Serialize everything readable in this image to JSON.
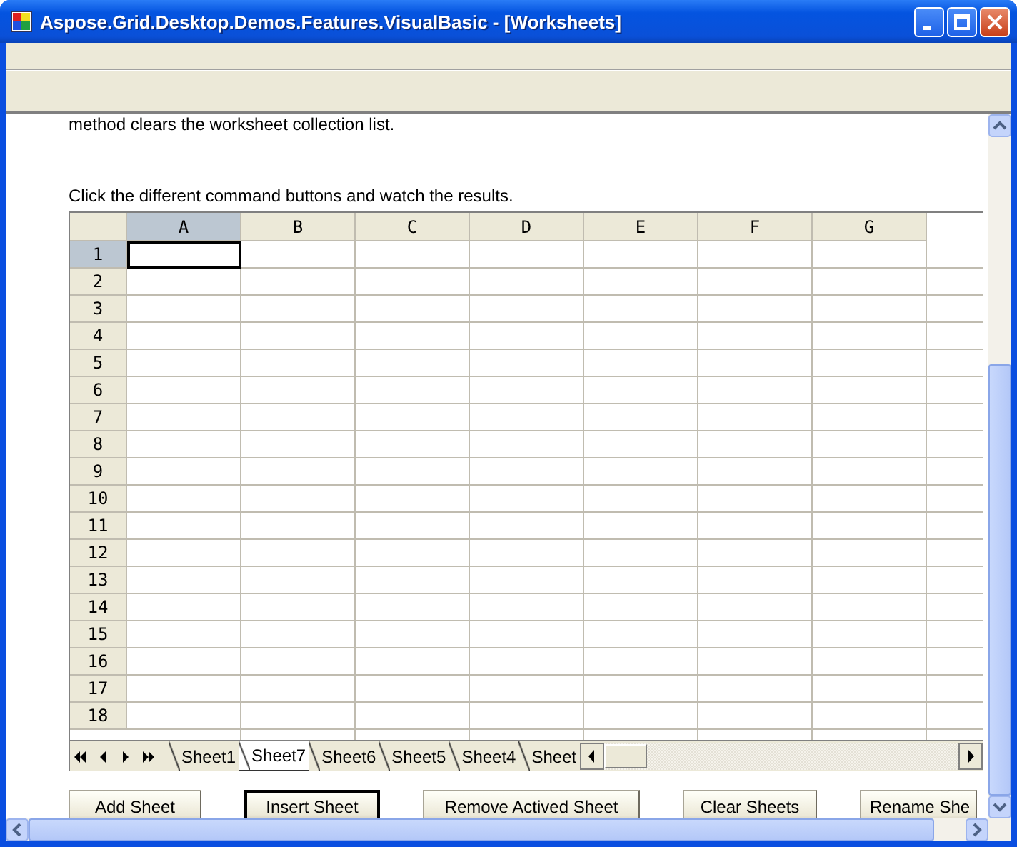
{
  "window": {
    "title": "Aspose.Grid.Desktop.Demos.Features.VisualBasic - [Worksheets]"
  },
  "description": [
    "method clears the worksheet collection list.",
    "Click the different command buttons and watch the results."
  ],
  "grid": {
    "columns": [
      {
        "label": "A",
        "selected": true
      },
      {
        "label": "B",
        "selected": false
      },
      {
        "label": "C",
        "selected": false
      },
      {
        "label": "D",
        "selected": false
      },
      {
        "label": "E",
        "selected": false
      },
      {
        "label": "F",
        "selected": false
      },
      {
        "label": "G",
        "selected": false
      }
    ],
    "rows": [
      {
        "label": "1",
        "selected": true
      },
      {
        "label": "2",
        "selected": false
      },
      {
        "label": "3",
        "selected": false
      },
      {
        "label": "4",
        "selected": false
      },
      {
        "label": "5",
        "selected": false
      },
      {
        "label": "6",
        "selected": false
      },
      {
        "label": "7",
        "selected": false
      },
      {
        "label": "8",
        "selected": false
      },
      {
        "label": "9",
        "selected": false
      },
      {
        "label": "10",
        "selected": false
      },
      {
        "label": "11",
        "selected": false
      },
      {
        "label": "12",
        "selected": false
      },
      {
        "label": "13",
        "selected": false
      },
      {
        "label": "14",
        "selected": false
      },
      {
        "label": "15",
        "selected": false
      },
      {
        "label": "16",
        "selected": false
      },
      {
        "label": "17",
        "selected": false
      },
      {
        "label": "18",
        "selected": false
      }
    ]
  },
  "sheet_tabs": [
    {
      "label": "Sheet1",
      "selected": false
    },
    {
      "label": "Sheet7",
      "selected": true
    },
    {
      "label": "Sheet6",
      "selected": false
    },
    {
      "label": "Sheet5",
      "selected": false
    },
    {
      "label": "Sheet4",
      "selected": false
    },
    {
      "label": "Sheet",
      "selected": false
    }
  ],
  "buttons": [
    {
      "label": "Add Sheet",
      "focused": false
    },
    {
      "label": "Insert Sheet",
      "focused": true
    },
    {
      "label": "Remove Actived Sheet",
      "focused": false
    },
    {
      "label": "Clear Sheets",
      "focused": false
    },
    {
      "label": "Rename She",
      "focused": false
    }
  ]
}
